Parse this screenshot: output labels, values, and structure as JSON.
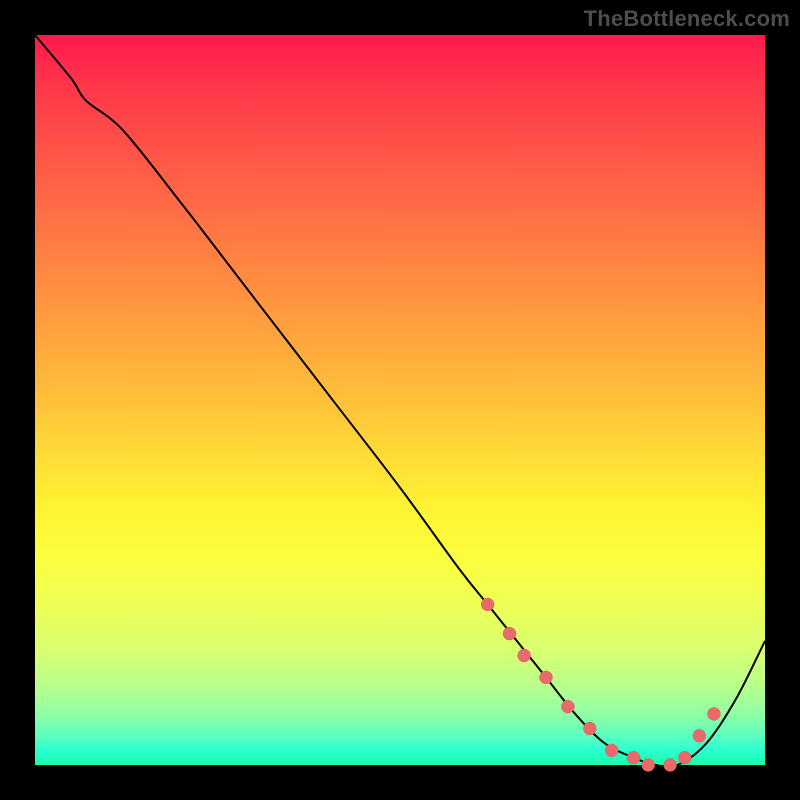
{
  "watermark": "TheBottleneck.com",
  "colors": {
    "curve_stroke": "#000000",
    "marker_fill": "#e96a6a",
    "marker_stroke": "#c94f4f",
    "background": "#000000"
  },
  "chart_data": {
    "type": "line",
    "title": "",
    "xlabel": "",
    "ylabel": "",
    "xlim": [
      0,
      100
    ],
    "ylim": [
      0,
      100
    ],
    "grid": false,
    "legend": false,
    "series": [
      {
        "name": "bottleneck-curve",
        "x": [
          0,
          5,
          7,
          12,
          20,
          30,
          40,
          50,
          58,
          62,
          66,
          70,
          74,
          78,
          82,
          85,
          88,
          92,
          96,
          100
        ],
        "y": [
          100,
          94,
          91,
          87,
          77,
          64,
          51,
          38,
          27,
          22,
          17,
          12,
          7,
          3,
          1,
          0,
          0,
          3,
          9,
          17
        ]
      }
    ],
    "markers": {
      "name": "highlight-points",
      "x": [
        62,
        65,
        67,
        70,
        73,
        76,
        79,
        82,
        84,
        87,
        89,
        91,
        93
      ],
      "y": [
        22,
        18,
        15,
        12,
        8,
        5,
        2,
        1,
        0,
        0,
        1,
        4,
        7
      ]
    }
  }
}
